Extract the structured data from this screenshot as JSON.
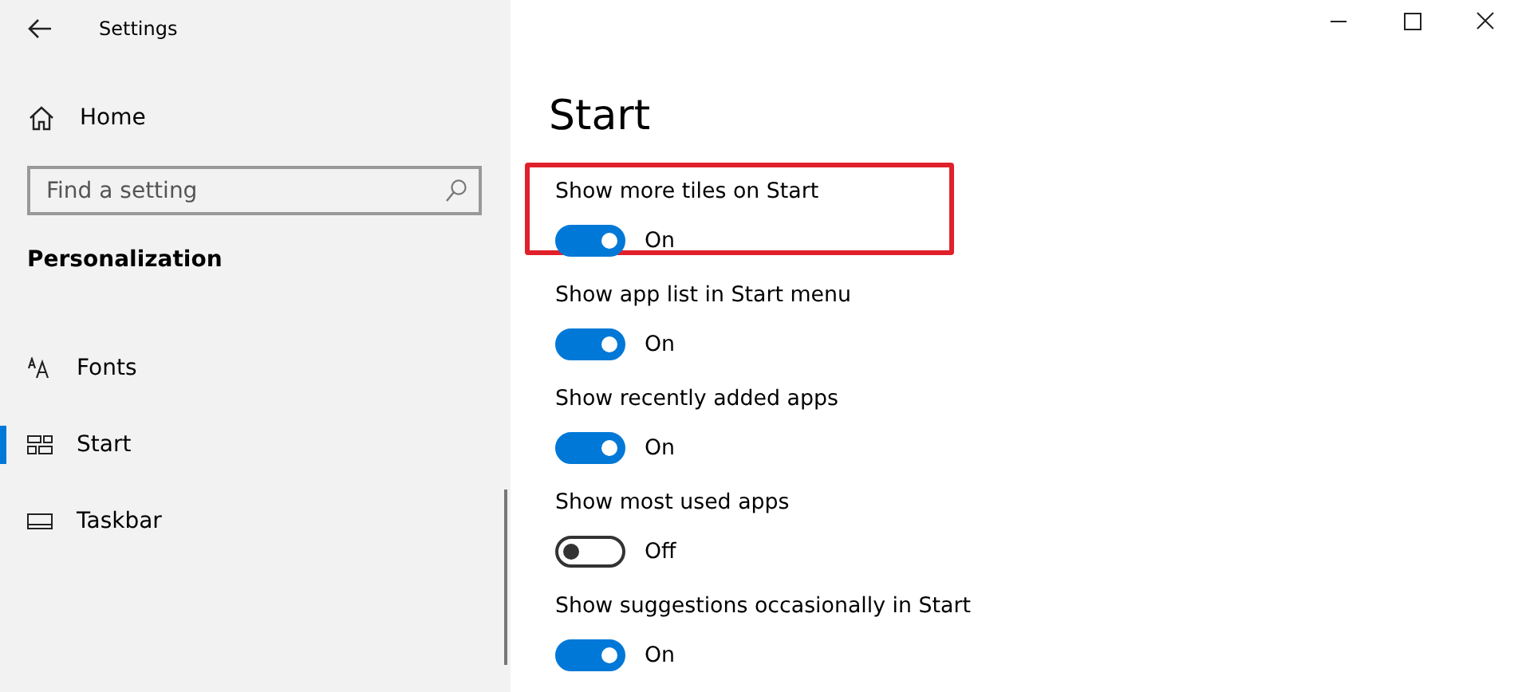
{
  "window": {
    "title": "Settings"
  },
  "sidebar": {
    "home": "Home",
    "search": {
      "placeholder": "Find a setting"
    },
    "section": "Personalization",
    "items": [
      {
        "label": "Fonts",
        "selected": false
      },
      {
        "label": "Start",
        "selected": true
      },
      {
        "label": "Taskbar",
        "selected": false
      }
    ]
  },
  "page": {
    "title": "Start",
    "settings": [
      {
        "label": "Show more tiles on Start",
        "on": true,
        "state": "On",
        "highlighted": true
      },
      {
        "label": "Show app list in Start menu",
        "on": true,
        "state": "On",
        "highlighted": false
      },
      {
        "label": "Show recently added apps",
        "on": true,
        "state": "On",
        "highlighted": false
      },
      {
        "label": "Show most used apps",
        "on": false,
        "state": "Off",
        "highlighted": false
      },
      {
        "label": "Show suggestions occasionally in Start",
        "on": true,
        "state": "On",
        "highlighted": false
      }
    ]
  }
}
